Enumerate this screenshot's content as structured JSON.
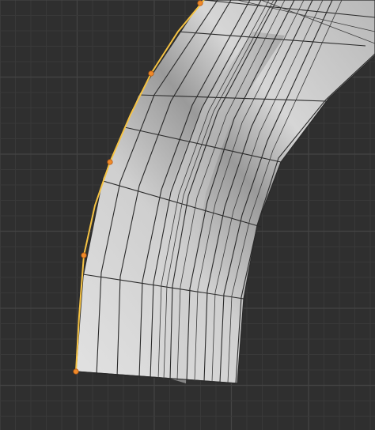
{
  "viewport": {
    "background": "#2f2f2f",
    "grid_color": "#3a3a3a",
    "mesh_fill_light": "#dcdcdc",
    "mesh_fill_dark": "#8e8e8e",
    "selection_color": "#f6c343",
    "vertex_color": "#f08a2a"
  },
  "mesh": {
    "icon": "curved-extrusion-mesh",
    "selected_edge_loop": "outer-left-edge",
    "selected_vertex_count": 5
  }
}
